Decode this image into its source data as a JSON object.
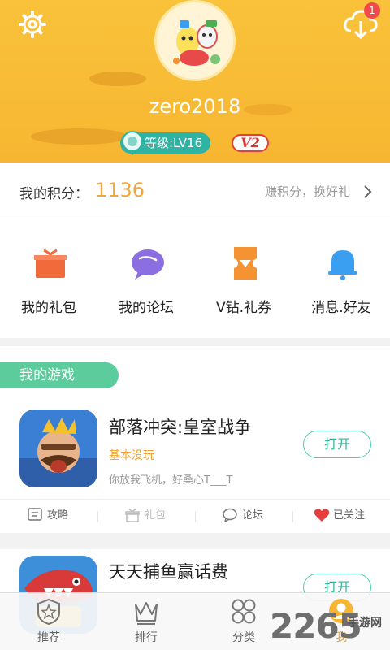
{
  "header": {
    "username": "zero2018",
    "download_badge": "1",
    "level_label": "等级:LV16",
    "vip_label": "V2"
  },
  "points": {
    "label": "我的积分：",
    "value": "1136",
    "link": "赚积分，换好礼"
  },
  "quick": [
    {
      "label": "我的礼包",
      "icon": "gift-icon",
      "color": "#f06a3c"
    },
    {
      "label": "我的论坛",
      "icon": "chat-icon",
      "color": "#8b6fe0"
    },
    {
      "label": "V钻.礼券",
      "icon": "coupon-icon",
      "color": "#f59231"
    },
    {
      "label": "消息.好友",
      "icon": "bell-icon",
      "color": "#3a9ff0"
    }
  ],
  "games": {
    "title": "我的游戏",
    "items": [
      {
        "name": "部落冲突:皇室战争",
        "status": "基本没玩",
        "desc": "你放我飞机，好桑心T___T",
        "open_label": "打开",
        "actions": {
          "guide": "攻略",
          "gift": "礼包",
          "forum": "论坛",
          "followed": "已关注"
        }
      },
      {
        "name": "天天捕鱼赢话费",
        "status": "",
        "desc": "",
        "open_label": "打开"
      }
    ]
  },
  "tabs": [
    {
      "label": "推荐",
      "icon": "star-shield-icon"
    },
    {
      "label": "排行",
      "icon": "crown-icon"
    },
    {
      "label": "分类",
      "icon": "grid-circles-icon"
    },
    {
      "label": "我",
      "icon": "person-icon",
      "active": true
    }
  ],
  "watermark": {
    "text": "2265",
    "small": "手游网"
  },
  "colors": {
    "header": "#f7b631",
    "accent": "#5dcc9c",
    "points": "#f3a737",
    "vip": "#e03030"
  }
}
